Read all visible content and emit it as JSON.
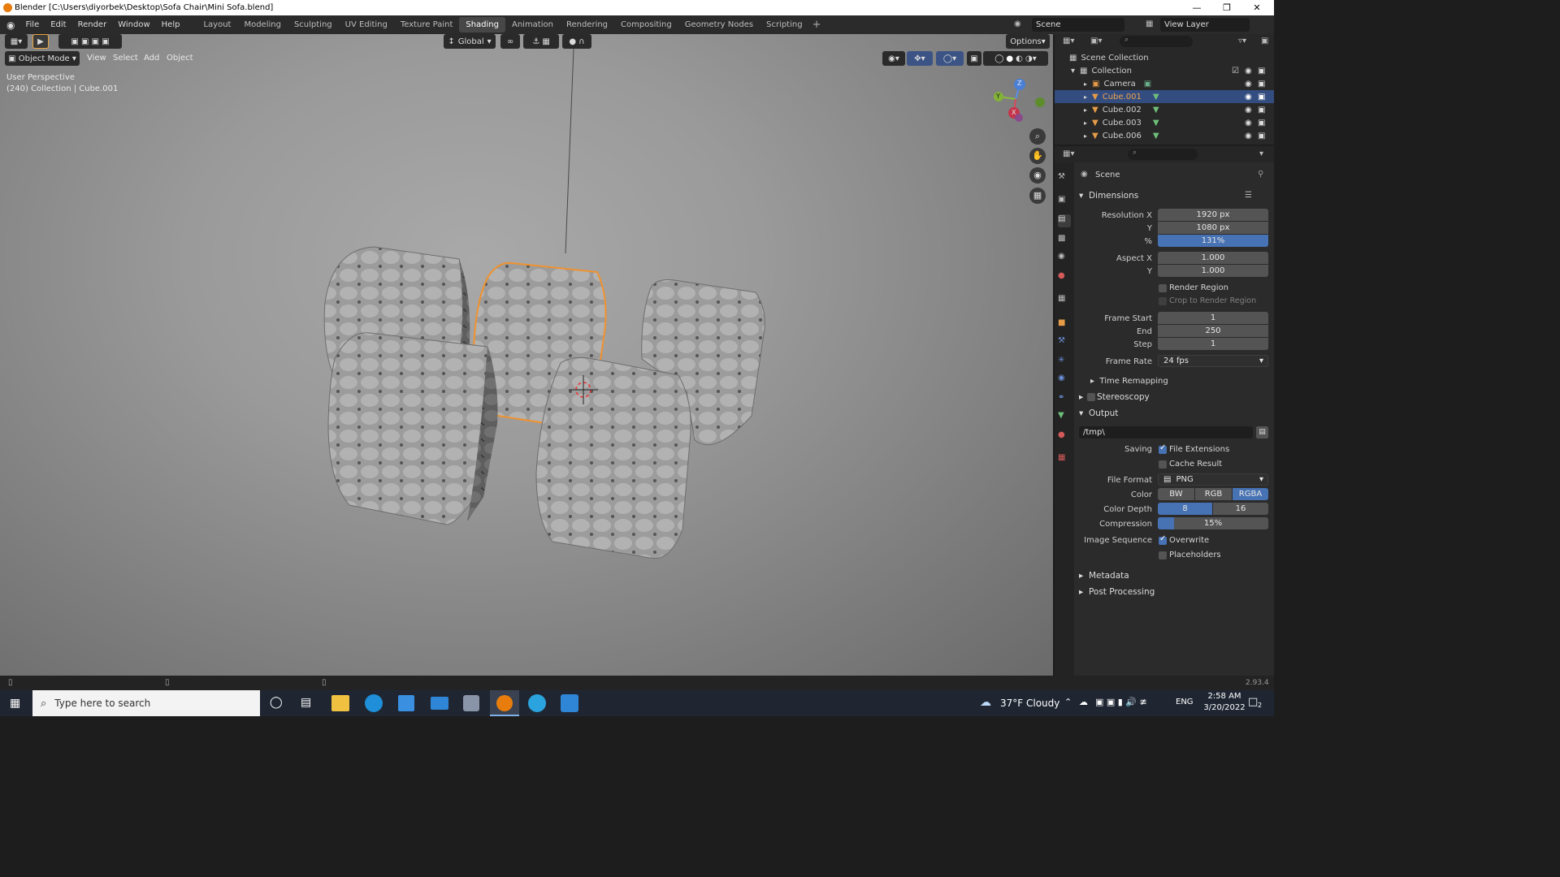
{
  "window": {
    "title": "Blender [C:\\Users\\diyorbek\\Desktop\\Sofa Chair\\Mini Sofa.blend]"
  },
  "menu": [
    "File",
    "Edit",
    "Render",
    "Window",
    "Help"
  ],
  "workspaces": [
    {
      "label": "Layout"
    },
    {
      "label": "Modeling"
    },
    {
      "label": "Sculpting"
    },
    {
      "label": "UV Editing"
    },
    {
      "label": "Texture Paint"
    },
    {
      "label": "Shading",
      "active": true
    },
    {
      "label": "Animation"
    },
    {
      "label": "Rendering"
    },
    {
      "label": "Compositing"
    },
    {
      "label": "Geometry Nodes"
    },
    {
      "label": "Scripting"
    }
  ],
  "topright": {
    "scene": "Scene",
    "view_layer": "View Layer"
  },
  "viewport": {
    "mode": "Object Mode",
    "menus": [
      "View",
      "Select",
      "Add",
      "Object"
    ],
    "transform": "Global",
    "options": "Options",
    "perspective": "User Perspective",
    "info": "(240) Collection | Cube.001",
    "gizmo": {
      "x": "X",
      "y": "Y",
      "z": "Z"
    }
  },
  "outliner": {
    "root": "Scene Collection",
    "collection": "Collection",
    "items": [
      {
        "name": "Camera",
        "selected": false
      },
      {
        "name": "Cube.001",
        "selected": true
      },
      {
        "name": "Cube.002",
        "selected": false
      },
      {
        "name": "Cube.003",
        "selected": false
      },
      {
        "name": "Cube.006",
        "selected": false
      }
    ]
  },
  "properties": {
    "context": "Scene",
    "dimensions": {
      "title": "Dimensions",
      "res_x_label": "Resolution X",
      "res_x": "1920 px",
      "res_y_label": "Y",
      "res_y": "1080 px",
      "res_pct_label": "%",
      "res_pct": "131%",
      "aspect_x_label": "Aspect X",
      "aspect_x": "1.000",
      "aspect_y_label": "Y",
      "aspect_y": "1.000",
      "render_region": "Render Region",
      "crop": "Crop to Render Region",
      "frame_start_label": "Frame Start",
      "frame_start": "1",
      "end_label": "End",
      "end": "250",
      "step_label": "Step",
      "step": "1",
      "frame_rate_label": "Frame Rate",
      "frame_rate": "24 fps",
      "time_remapping": "Time Remapping"
    },
    "stereoscopy": "Stereoscopy",
    "output": {
      "title": "Output",
      "path": "/tmp\\",
      "saving_label": "Saving",
      "file_extensions": "File Extensions",
      "cache_result": "Cache Result",
      "file_format_label": "File Format",
      "file_format": "PNG",
      "color_label": "Color",
      "color_options": [
        "BW",
        "RGB",
        "RGBA"
      ],
      "color_selected": "RGBA",
      "depth_label": "Color Depth",
      "depth_options": [
        "8",
        "16"
      ],
      "depth_selected": "8",
      "compression_label": "Compression",
      "compression": "15%",
      "compression_fraction": 0.15,
      "image_sequence_label": "Image Sequence",
      "overwrite": "Overwrite",
      "placeholders": "Placeholders"
    },
    "metadata": "Metadata",
    "post_processing": "Post Processing"
  },
  "statusbar": {
    "version": "2.93.4"
  },
  "taskbar": {
    "search_placeholder": "Type here to search",
    "weather": "37°F  Cloudy",
    "lang": "ENG",
    "time": "2:58 AM",
    "date": "3/20/2022",
    "badge": "2"
  }
}
